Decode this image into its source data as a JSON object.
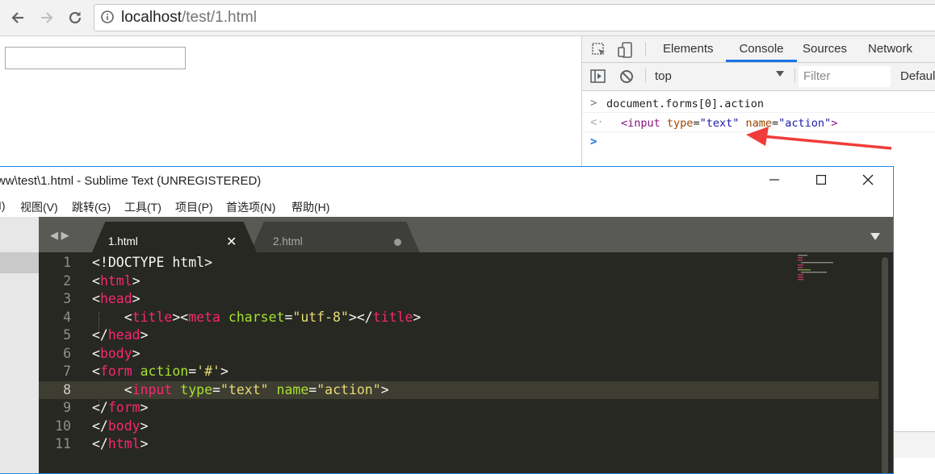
{
  "browser": {
    "url_host": "localhost",
    "url_path": "/test/1.html"
  },
  "devtools": {
    "tabs": [
      "Elements",
      "Console",
      "Sources",
      "Network"
    ],
    "active_tab": "Console",
    "context": "top",
    "filter_placeholder": "Filter",
    "levels": "Defaul",
    "console": {
      "input": "document.forms[0].action",
      "result": {
        "open": "<",
        "tag": "input",
        "attr1": "type",
        "val1": "\"text\"",
        "attr2": "name",
        "val2": "\"action\"",
        "close": ">"
      }
    }
  },
  "sublime": {
    "title": "ww\\test\\1.html - Sublime Text (UNREGISTERED)",
    "menu": [
      "I)",
      "视图(V)",
      "跳转(G)",
      "工具(T)",
      "项目(P)",
      "首选项(N)",
      "帮助(H)"
    ],
    "tabs": [
      {
        "label": "1.html"
      },
      {
        "label": "2.html"
      }
    ],
    "highlighted_line": 8,
    "lines": [
      {
        "n": "1"
      },
      {
        "n": "2"
      },
      {
        "n": "3"
      },
      {
        "n": "4"
      },
      {
        "n": "5"
      },
      {
        "n": "6"
      },
      {
        "n": "7"
      },
      {
        "n": "8"
      },
      {
        "n": "9"
      },
      {
        "n": "10"
      },
      {
        "n": "11"
      }
    ],
    "code": {
      "l1": "<!DOCTYPE html>",
      "html": "html",
      "head": "head",
      "title": "title",
      "meta": "meta",
      "charset": "charset",
      "utf8": "\"utf-8\"",
      "body": "body",
      "form": "form",
      "action": "action",
      "hash": "'#'",
      "input": "input",
      "type": "type",
      "text": "\"text\"",
      "name": "name",
      "action_val": "\"action\""
    }
  },
  "colors": {
    "devtools_accent": "#1a73e8",
    "annotation_arrow": "#f03c3c",
    "editor_bg": "#272822",
    "keyword": "#f92672",
    "attribute": "#a6e22e",
    "string": "#e6db74"
  },
  "icons": [
    "back-arrow-icon",
    "forward-arrow-icon",
    "reload-icon",
    "info-icon",
    "inspect-icon",
    "device-icon",
    "sidebar-toggle-icon",
    "clear-console-icon",
    "minimize-icon",
    "maximize-icon",
    "close-icon"
  ]
}
